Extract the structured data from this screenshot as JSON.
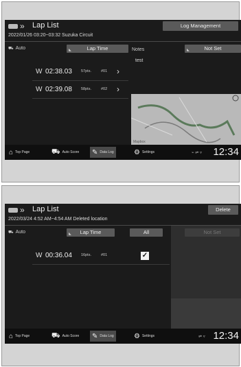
{
  "screen1": {
    "title": "Lap List",
    "action_button": "Log Management",
    "subtitle": "2022/01/26 03:20~03:32 Suzuka Circuit",
    "mode_label": "Auto",
    "sort_button": "Lap Time",
    "notes_label": "Notes",
    "notes_value_button": "Not Set",
    "notes_text": "test",
    "laps": [
      {
        "time": "02:38.03",
        "points": "57pts.",
        "lap": "#01"
      },
      {
        "time": "02:39.08",
        "points": "58pts.",
        "lap": "#02"
      }
    ],
    "nav": [
      "Top Page",
      "Auto Score",
      "Data Log",
      "Settings"
    ],
    "clock": "12:34",
    "map_credit": "Mapbox"
  },
  "screen2": {
    "title": "Lap List",
    "action_button": "Delete",
    "subtitle": "2022/03/24 4:52 AM~4:54 AM Deleted location",
    "mode_label": "Auto",
    "sort_button": "Lap Time",
    "all_button": "All",
    "notes_value_button": "Not Set",
    "laps": [
      {
        "time": "00:36.04",
        "points": "16pts.",
        "lap": "#01",
        "checked": true
      }
    ],
    "nav": [
      "Top Page",
      "Auto Score",
      "Data Log",
      "Settings"
    ],
    "clock": "12:34"
  },
  "icons": {
    "lap_marker": "W",
    "arrow": "›",
    "check": "✓",
    "home": "⌂",
    "car": "⛟",
    "datalog": "✎",
    "settings": "⚙"
  }
}
